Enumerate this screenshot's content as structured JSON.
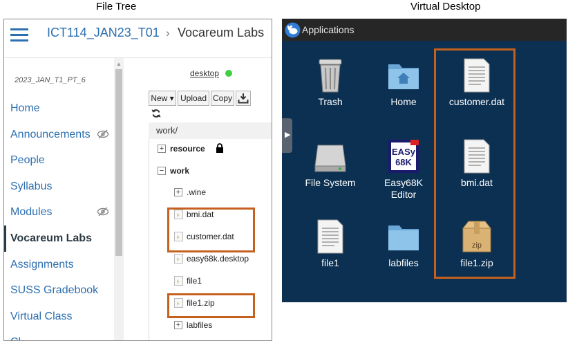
{
  "captions": {
    "left": "File Tree",
    "right": "Virtual Desktop"
  },
  "canvas": {
    "breadcrumb": {
      "course": "ICT114_JAN23_T01",
      "separator": "›",
      "current": "Vocareum Labs"
    },
    "term": "2023_JAN_T1_PT_6",
    "nav": [
      {
        "label": "Home",
        "icon": ""
      },
      {
        "label": "Announcements",
        "icon": "eye-slash-icon"
      },
      {
        "label": "People",
        "icon": ""
      },
      {
        "label": "Syllabus",
        "icon": ""
      },
      {
        "label": "Modules",
        "icon": "eye-slash-icon"
      },
      {
        "label": "Vocareum Labs",
        "icon": "",
        "active": true
      },
      {
        "label": "Assignments",
        "icon": ""
      },
      {
        "label": "SUSS Gradebook",
        "icon": ""
      },
      {
        "label": "Virtual Class",
        "icon": ""
      },
      {
        "label": "Cl",
        "icon": ""
      }
    ]
  },
  "file_manager": {
    "desktop_link": "desktop",
    "status_color": "#3fcf3f",
    "toolbar": {
      "new": "New ▾",
      "upload": "Upload",
      "copy": "Copy",
      "download_icon": "download-icon"
    },
    "refresh_icon": "refresh-icon",
    "path": "work/",
    "tree": {
      "resource": "resource",
      "resource_expander": "+",
      "work": "work",
      "work_expander": "−",
      "wine": ".wine",
      "wine_expander": "+",
      "bmi": "bmi.dat",
      "customer": "customer.dat",
      "easy68k": "easy68k.desktop",
      "file1": "file1",
      "file1zip": "file1.zip",
      "labfiles": "labfiles",
      "labfiles_expander": "+"
    }
  },
  "desktop": {
    "menu_label": "Applications",
    "icons": {
      "trash": "Trash",
      "home": "Home",
      "customer": "customer.dat",
      "filesystem": "File System",
      "easy68k_line1": "Easy68K",
      "easy68k_line2": "Editor",
      "bmi": "bmi.dat",
      "file1": "file1",
      "labfiles": "labfiles",
      "file1zip": "file1.zip"
    },
    "easy68k_badge": [
      "EASy",
      "68K"
    ],
    "zip_badge": "zip"
  },
  "highlight_color": "#c5611f",
  "colors": {
    "link": "#2d6fb0",
    "desktop_bg": "#0b3052",
    "topbar_bg": "#262626"
  }
}
